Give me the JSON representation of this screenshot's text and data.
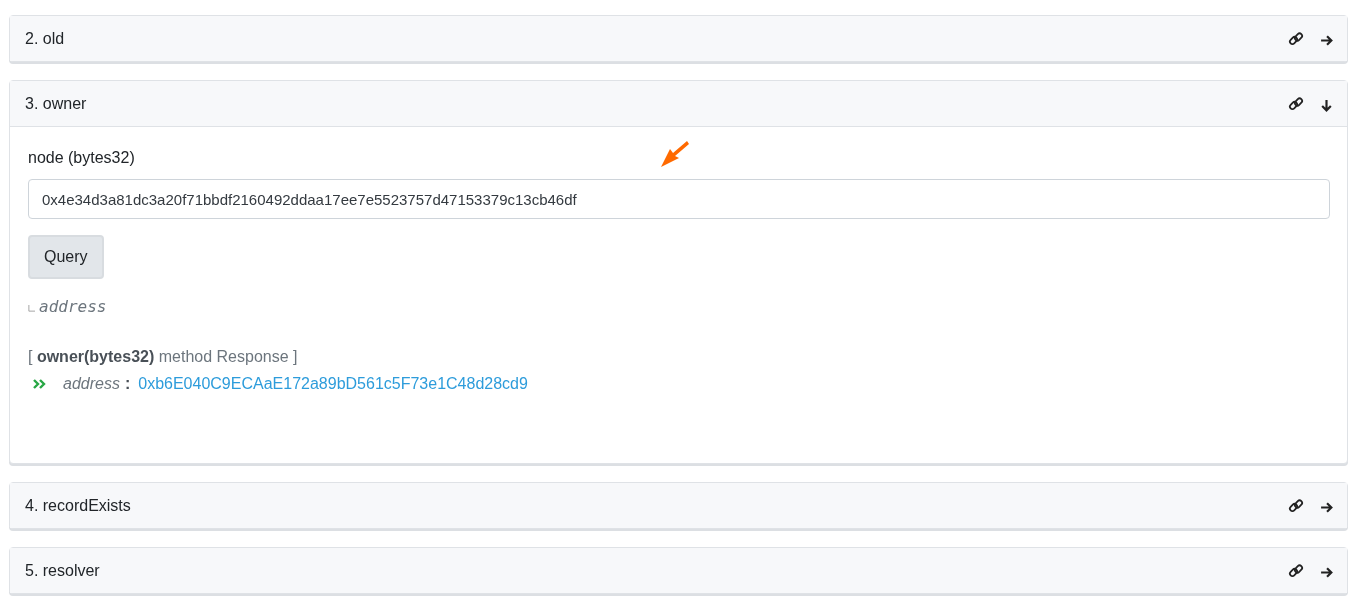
{
  "sections": [
    {
      "title": "2. old",
      "expanded": false
    },
    {
      "title": "3. owner",
      "expanded": true,
      "input": {
        "label": "node (bytes32)",
        "value": "0x4e34d3a81dc3a20f71bbdf2160492ddaa17ee7e5523757d47153379c13cb46df"
      },
      "button": "Query",
      "output_type": "address",
      "response": {
        "heading": "[ **owner(bytes32)** method Response ]",
        "param": "address",
        "separator": ":",
        "value": "0xb6E040C9ECAaE172a89bD561c5F73e1C48d28cd9"
      }
    },
    {
      "title": "4. recordExists",
      "expanded": false
    },
    {
      "title": "5. resolver",
      "expanded": false
    }
  ]
}
